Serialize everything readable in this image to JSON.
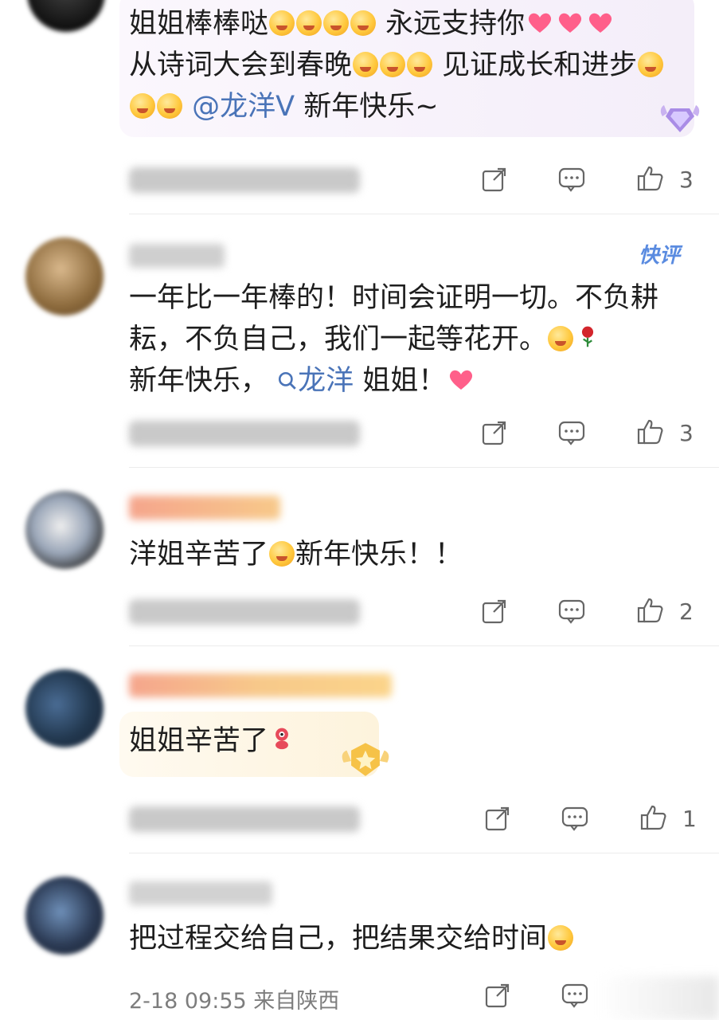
{
  "comments": [
    {
      "id": "c1",
      "text_parts": [
        "姐姐棒棒哒",
        " 永远支持你",
        "从诗词大会到春晚",
        " 见证成长和进步",
        "@龙洋V",
        " 新年快乐~"
      ],
      "likes": "3"
    },
    {
      "id": "c2",
      "tag": "快评",
      "text_parts": [
        "一年比一年棒的！时间会证明一切。不负耕耘，不负自己，我们一起等花开。",
        "新年快乐，",
        "龙洋",
        " 姐姐！"
      ],
      "likes": "3"
    },
    {
      "id": "c3",
      "text_parts": [
        "洋姐辛苦了",
        "新年快乐！！"
      ],
      "likes": "2"
    },
    {
      "id": "c4",
      "text_parts": [
        "姐姐辛苦了"
      ],
      "likes": "1"
    },
    {
      "id": "c5",
      "text_parts": [
        "把过程交给自己，把结果交给时间"
      ],
      "meta": "2-18 09:55  来自陕西"
    }
  ],
  "icons": [
    "share-icon",
    "comment-icon",
    "like-icon",
    "search-icon",
    "emoji-icon",
    "heart-icon",
    "rose-icon",
    "diamond-badge-icon",
    "star-badge-icon"
  ],
  "colors": {
    "mention": "#4a74b8",
    "meta": "#7d7d7d",
    "kuaiping": "#5a8be0"
  }
}
